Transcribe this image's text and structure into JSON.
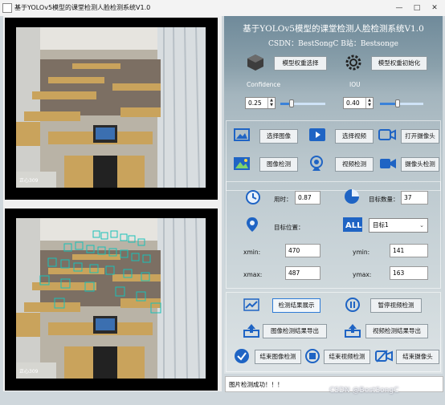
{
  "window": {
    "title": "基于YOLOv5模型的课堂检测人脸检测系统V1.0",
    "minimize": "—",
    "maximize": "□",
    "close": "✕"
  },
  "header": {
    "title": "基于YOLOv5模型的课堂检测人脸检测系统V1.0",
    "credits": "CSDN：BestSongC   B站：Bestsonge"
  },
  "weights": {
    "select_label": "模型权重选择",
    "init_label": "模型权重初始化"
  },
  "params": {
    "confidence_label": "Confidence",
    "confidence_value": "0.25",
    "confidence_level": 0.25,
    "iou_label": "IOU",
    "iou_value": "0.40",
    "iou_level": 0.4
  },
  "sources": {
    "select_image": "选择图像",
    "select_video": "选择视频",
    "open_camera": "打开摄像头",
    "image_detect": "图像检测",
    "video_detect": "视频检测",
    "camera_detect": "摄像头检测"
  },
  "results": {
    "time_label": "用时：",
    "time_value": "0.87",
    "count_label": "目标数量：",
    "count_value": "37",
    "position_label": "目标位置：",
    "target_select": "目标1",
    "xmin_label": "xmin:",
    "xmin_value": "470",
    "ymin_label": "ymin:",
    "ymin_value": "141",
    "xmax_label": "xmax:",
    "xmax_value": "487",
    "ymax_label": "ymax:",
    "ymax_value": "163"
  },
  "actions": {
    "show_result": "检测结果展示",
    "pause_video": "暂停视频检测",
    "export_image": "图像检测结果导出",
    "export_video": "视频检测结果导出",
    "stop_image": "结束图像检测",
    "stop_video": "结束视频检测",
    "stop_camera": "结束摄像头"
  },
  "status": {
    "message": "图片检测成功！！！"
  },
  "frames": {
    "top_caption": "正心309",
    "bottom_caption": "正心309"
  },
  "watermark": "CSDN @BestSongC",
  "colors": {
    "accent": "#2f7bd6",
    "box": "#19c2b8"
  }
}
